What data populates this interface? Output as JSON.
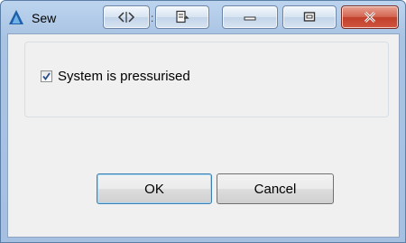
{
  "window": {
    "title": "Sew",
    "title_separator": ":",
    "buttons": {
      "nav": "nav-arrows-icon",
      "dock": "dock-icon",
      "minimize": "minimize-icon",
      "maximize": "maximize-icon",
      "close": "close-icon"
    },
    "colors": {
      "titlebar": "#a9c3e3",
      "close": "#c13f2b",
      "client": "#f0f0f0"
    }
  },
  "group": {
    "checkbox": {
      "label": "System is pressurised",
      "checked": true
    }
  },
  "actions": {
    "ok_label": "OK",
    "cancel_label": "Cancel"
  }
}
